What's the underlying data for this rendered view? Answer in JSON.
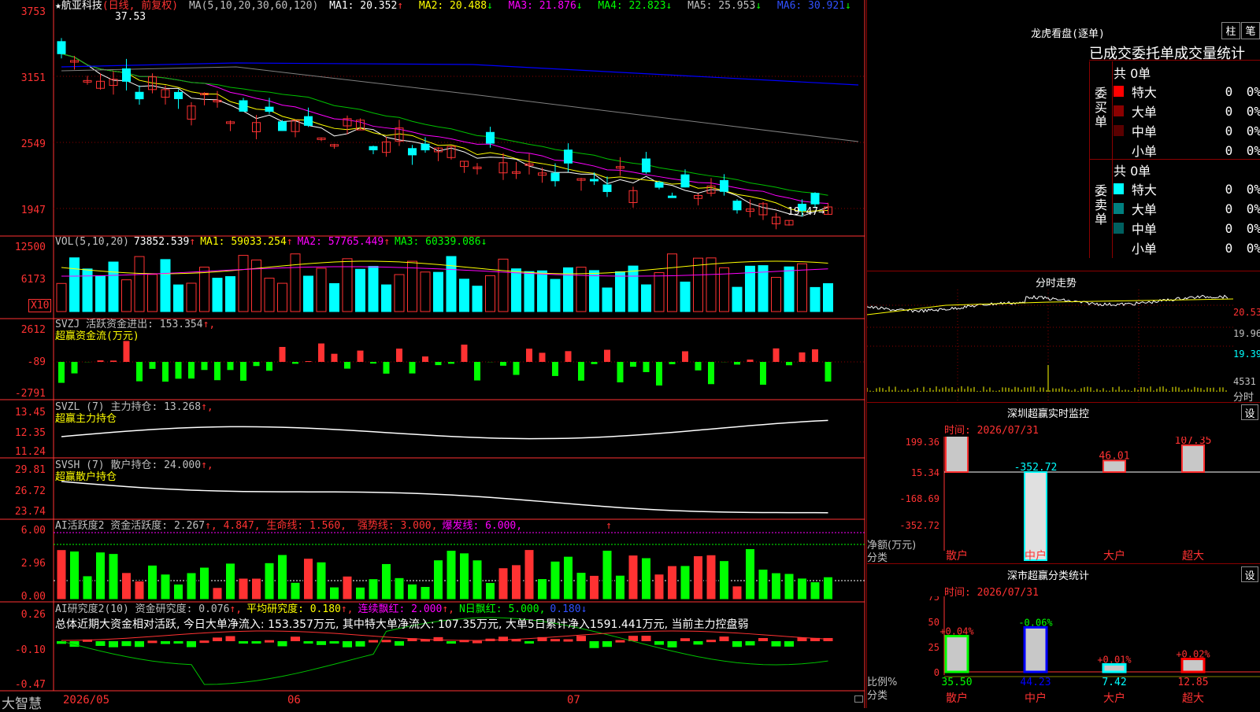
{
  "colors": {
    "up": "#ff3232",
    "down": "#00ffff",
    "grid": "#8b0000",
    "ma1": "#ffffff",
    "ma2": "#ffff00",
    "ma3": "#ff00ff",
    "ma4": "#00c000",
    "ma5": "#808080",
    "ma6": "#0000ff"
  },
  "main": {
    "title": "★航亚科技",
    "period": "(日线, 前复权)",
    "ma_name": "MA(5,10,20,30,60,120)",
    "ma": [
      {
        "label": "MA1: 20.352",
        "arrow": "↑"
      },
      {
        "label": "MA2: 20.488",
        "arrow": "↓"
      },
      {
        "label": "MA3: 21.876",
        "arrow": "↓"
      },
      {
        "label": "MA4: 22.823",
        "arrow": "↓"
      },
      {
        "label": "MA5: 25.953",
        "arrow": "↓"
      },
      {
        "label": "MA6: 30.921",
        "arrow": "↓"
      }
    ],
    "y_ticks": [
      "3753",
      "3151",
      "2549",
      "1947"
    ],
    "high_label": "37.53",
    "low_label": "19.47→"
  },
  "vol": {
    "title": "VOL(5,10,20)",
    "value": "73852.539",
    "v_arrow": "↑",
    "ma1": "MA1: 59033.254",
    "ma1_arrow": "↑",
    "ma2": "MA2: 57765.449",
    "ma2_arrow": "↑",
    "ma3": "MA3: 60339.086",
    "ma3_arrow": "↓",
    "y_ticks": [
      "12500",
      "6173"
    ],
    "unit": "X10"
  },
  "svzj": {
    "title": "SVZJ  活跃资金进出: 153.354",
    "arrow": "↑,",
    "sub": "超赢资金流(万元)",
    "y_ticks": [
      "2612",
      "-89",
      "-2791"
    ]
  },
  "svzl": {
    "title": "SVZL (7) 主力持仓: 13.268",
    "arrow": "↑,",
    "sub": "超赢主力持仓",
    "y_ticks": [
      "13.45",
      "12.35",
      "11.24"
    ]
  },
  "svsh": {
    "title": "SVSH (7) 散户持仓: 24.000",
    "arrow": "↑,",
    "sub": "超赢散户持仓",
    "y_ticks": [
      "29.81",
      "26.72",
      "23.74"
    ]
  },
  "ai1": {
    "title": "AI活跃度2 资金活跃度: 2.267",
    "a1": "↑, 4.847, 生命线: 1.560,",
    "strong": "强势线: 3.000,",
    "burst": "爆发线: 6.000,",
    "arrow2": "↑",
    "y_ticks": [
      "6.00",
      "2.96",
      "0.00"
    ]
  },
  "ai2": {
    "title": "AI研究度2(10) 资金研究度: 0.076",
    "a1": "↑,",
    "avg": "平均研究度: 0.180",
    "a2": "↑,",
    "cont": "连续飘红: 2.000",
    "a3": "↑,",
    "nday": "N日飘红: 5.000,",
    "last": "0.180",
    "a4": "↓",
    "summary": "总体近期大资金相对活跃, 今日大单净流入: 153.357万元, 其中特大单净流入: 107.35万元, 大单5日累计净入1591.441万元, 当前主力控盘弱",
    "y_ticks": [
      "0.26",
      "-0.10",
      "-0.47"
    ]
  },
  "xaxis": {
    "brand": "大智慧",
    "labels": [
      "2026/05",
      "06",
      "07"
    ]
  },
  "lhb": {
    "title": "龙虎看盘(逐单)",
    "btn1": "柱",
    "btn2": "笔",
    "header": "已成交委托单成交量统计",
    "buy": {
      "label": "委买单",
      "total": "共 0单",
      "rows": [
        {
          "name": "特大",
          "vol": "0",
          "pct": "0%",
          "color": "#ff0000"
        },
        {
          "name": "大单",
          "vol": "0",
          "pct": "0%",
          "color": "#8b0000"
        },
        {
          "name": "中单",
          "vol": "0",
          "pct": "0%",
          "color": "#5a0000"
        },
        {
          "name": "小单",
          "vol": "0",
          "pct": "0%",
          "color": "#000"
        }
      ]
    },
    "sell": {
      "label": "委卖单",
      "total": "共 0单",
      "rows": [
        {
          "name": "特大",
          "vol": "0",
          "pct": "0%",
          "color": "#00ffff"
        },
        {
          "name": "大单",
          "vol": "0",
          "pct": "0%",
          "color": "#008080"
        },
        {
          "name": "中单",
          "vol": "0",
          "pct": "0%",
          "color": "#006060"
        },
        {
          "name": "小单",
          "vol": "0",
          "pct": "0%",
          "color": "#000"
        }
      ]
    }
  },
  "fs": {
    "title": "分时走势",
    "y_ticks": [
      "20.53",
      "19.96",
      "19.39"
    ],
    "vol_label": "4531",
    "fs_label": "分时"
  },
  "monitor": {
    "title": "深圳超赢实时监控",
    "btn": "设",
    "time": "时间: 2026/07/31",
    "y_ticks": [
      "199.36",
      "15.34",
      "-168.69",
      "-352.72"
    ],
    "y_name": "净额(万元)",
    "x_name": "分类",
    "cats": [
      "散户",
      "中户",
      "大户",
      "超大"
    ],
    "values": [
      "199.36",
      "-352.72",
      "46.01",
      "107.35"
    ]
  },
  "classify": {
    "title": "深市超赢分类统计",
    "btn": "设",
    "time": "时间: 2026/07/31",
    "y_ticks": [
      "75",
      "50",
      "25",
      "0"
    ],
    "y_name": "比例%",
    "x_name": "分类",
    "cats": [
      "散户",
      "中户",
      "大户",
      "超大"
    ],
    "pcts": [
      "+0.04%",
      "-0.06%",
      "+0.01%",
      "+0.02%"
    ],
    "values": [
      "35.50",
      "44.23",
      "7.42",
      "12.85"
    ]
  }
}
